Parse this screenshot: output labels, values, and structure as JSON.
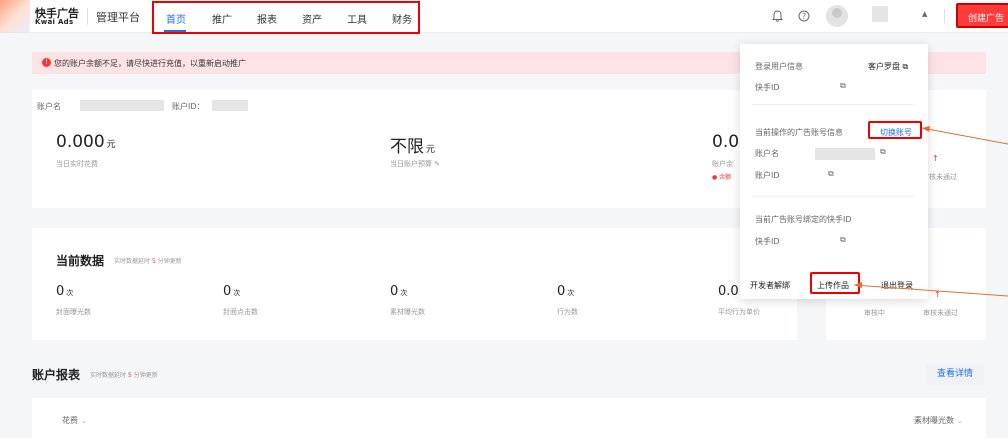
{
  "header": {
    "logo_cn": "快手广告",
    "logo_en": "Kwai Ads",
    "platform": "管理平台",
    "nav": [
      "首页",
      "推广",
      "报表",
      "资产",
      "工具",
      "财务"
    ],
    "bell_icon": "bell-icon",
    "help_icon": "question-circle-icon",
    "create_label": "创建广告"
  },
  "alert": {
    "text": "您的账户余额不足，请尽快进行充值，以重新启动推广",
    "icon": "exclamation-icon"
  },
  "account": {
    "name_label": "账户名",
    "id_label": "账户ID：",
    "today_cost_value": "0.000",
    "today_cost_unit": "元",
    "today_cost_label": "当日实时花费",
    "budget_value": "不限",
    "budget_unit": "元",
    "budget_label": "当日账户预算",
    "balance_value": "0.0",
    "balance_label": "账户余",
    "balance_warn": "余额",
    "reject_label": "审核未通过"
  },
  "current": {
    "title": "当前数据",
    "hint_prefix": "实时数据延时",
    "hint_num": "5",
    "hint_suffix": "分钟更新",
    "metrics": [
      {
        "value": "0",
        "unit": "次",
        "label": "封面曝光数"
      },
      {
        "value": "0",
        "unit": "次",
        "label": "封面点击数"
      },
      {
        "value": "0",
        "unit": "次",
        "label": "素材曝光数"
      },
      {
        "value": "0",
        "unit": "次",
        "label": "行为数"
      },
      {
        "value": "0.0",
        "unit": "",
        "label": "平均行为单价"
      }
    ],
    "review_label": "审核中",
    "reject_label": "审核未通过"
  },
  "report": {
    "title": "账户报表",
    "hint_prefix": "实时数据延时",
    "hint_num": "5",
    "hint_suffix": "分钟更新",
    "detail_label": "查看详情",
    "col_left": "花费",
    "col_right": "素材曝光数"
  },
  "popup": {
    "login_info": "登录用户信息",
    "customer_name": "客户罗盘",
    "kuaishou_id_label": "快手ID",
    "current_account_info": "当前操作的广告账号信息",
    "switch_label": "切换账号",
    "account_name_label": "账户名",
    "account_id_label": "账户ID",
    "bound_label": "当前广告账号绑定的快手ID",
    "bound_id_label": "快手ID",
    "dev_unbind": "开发者解绑",
    "upload_label": "上传作品",
    "logout_label": "退出登录"
  },
  "colors": {
    "accent": "#1b6df5",
    "danger": "#fe3a3a",
    "alert_bg": "#fde3e6"
  }
}
